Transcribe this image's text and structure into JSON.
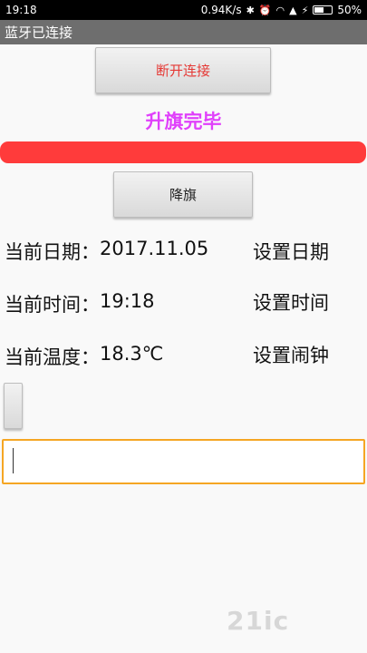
{
  "status_bar": {
    "time": "19:18",
    "net_speed": "0.94K/s",
    "battery": "50%"
  },
  "app_bar": {
    "title": "蓝牙已连接"
  },
  "buttons": {
    "disconnect": "断开连接",
    "lower_flag": "降旗"
  },
  "flag_status": "升旗完毕",
  "info": {
    "date_label": "当前日期：",
    "date_value": "2017.11.05",
    "time_label": "当前时间：",
    "time_value": "19:18",
    "temp_label": "当前温度：",
    "temp_value": "18.3℃"
  },
  "actions": {
    "set_date": "设置日期",
    "set_time": "设置时间",
    "set_alarm": "设置闹钟"
  },
  "watermark": "21ic"
}
